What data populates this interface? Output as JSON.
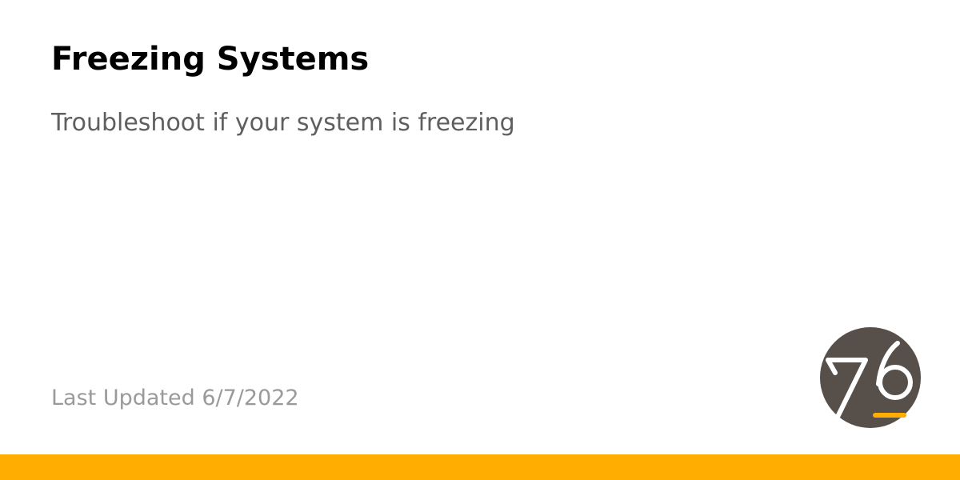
{
  "page": {
    "title": "Freezing Systems",
    "subtitle": "Troubleshoot if your system is freezing",
    "last_updated": "Last Updated 6/7/2022"
  },
  "logo": {
    "icon": "system76-logo-icon",
    "text": "76"
  },
  "colors": {
    "title": "#000000",
    "subtitle": "#5f5f5f",
    "last_updated": "#9a9a9a",
    "accent": "#ffad00",
    "logo_circle": "#574f4a",
    "logo_glyph": "#ffffff"
  }
}
